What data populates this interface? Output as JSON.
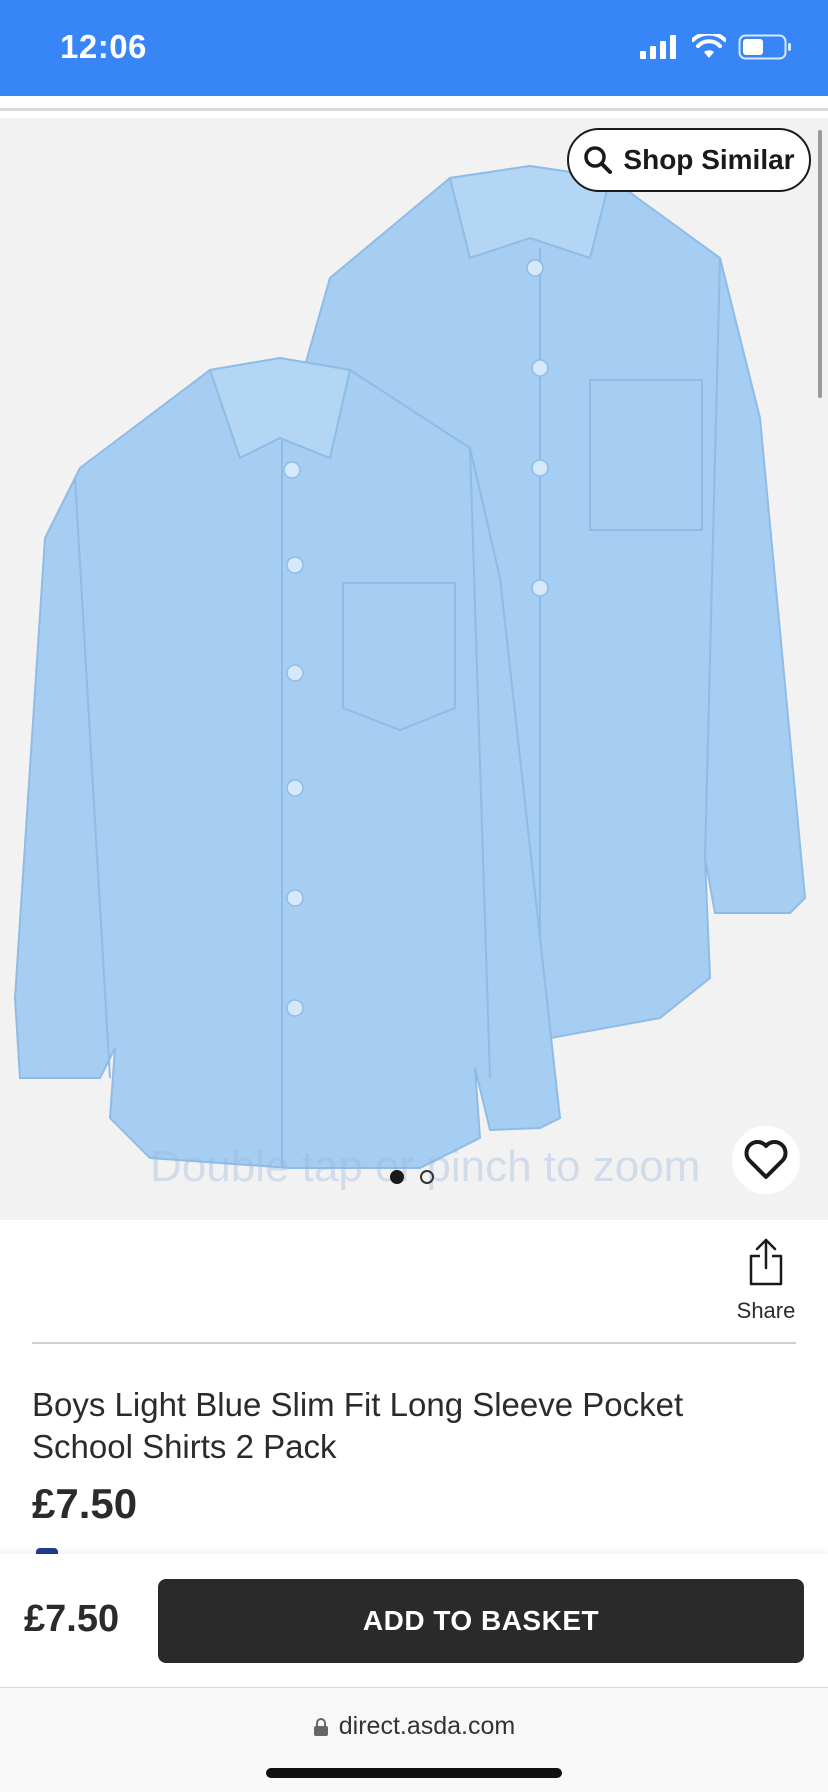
{
  "status_bar": {
    "time": "12:06",
    "icons": [
      "signal-icon",
      "wifi-icon",
      "battery-icon"
    ],
    "background": "#3885f8"
  },
  "gallery": {
    "shop_similar_label": "Shop Similar",
    "zoom_hint": "Double tap or pinch to zoom",
    "image_count": 2,
    "active_index": 1,
    "shirt_color": "#a6cdf2"
  },
  "share": {
    "label": "Share"
  },
  "product": {
    "title": "Boys Light Blue Slim Fit Long Sleeve Pocket School Shirts 2 Pack",
    "price": "£7.50"
  },
  "sticky": {
    "price": "£7.50",
    "button_label": "ADD TO BASKET"
  },
  "browser": {
    "url": "direct.asda.com"
  }
}
